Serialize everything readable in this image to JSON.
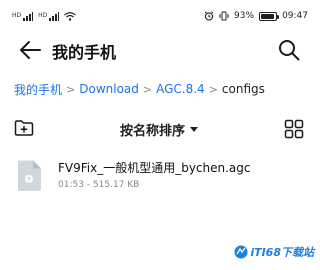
{
  "status_bar": {
    "sig1_label": "HD",
    "sig2_label": "HD",
    "battery_percent": "93%",
    "battery_level": 0.93,
    "time": "09:47"
  },
  "header": {
    "title": "我的手机"
  },
  "breadcrumb": [
    {
      "label": "我的手机"
    },
    {
      "label": "Download"
    },
    {
      "label": "AGC.8.4"
    },
    {
      "label": "configs"
    }
  ],
  "toolbar": {
    "sort_label": "按名称排序"
  },
  "files": [
    {
      "name": "FV9Fix_一般机型通用_bychen.agc",
      "meta": "01:53 - 515.17 KB"
    }
  ],
  "watermark": {
    "text": "iTI68下载站"
  },
  "colors": {
    "accent": "#1a73e8",
    "file_icon": "#cfd8dc",
    "watermark": "#1d7fe0"
  }
}
